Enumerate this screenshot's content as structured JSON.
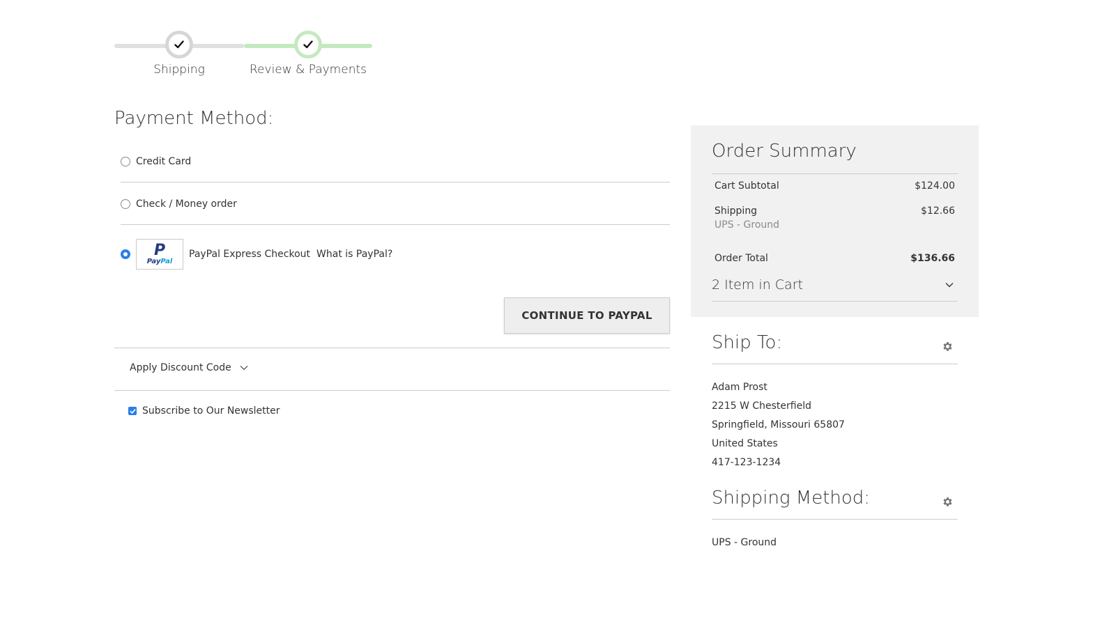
{
  "progress": {
    "steps": [
      {
        "label": "Shipping",
        "state": "complete"
      },
      {
        "label": "Review & Payments",
        "state": "active"
      }
    ],
    "colors": {
      "complete": "#d6d6d6",
      "active": "#c4e9c0"
    }
  },
  "payment": {
    "title": "Payment Method:",
    "options": [
      {
        "label": "Credit Card",
        "selected": false
      },
      {
        "label": "Check / Money order",
        "selected": false
      },
      {
        "label": "PayPal Express Checkout",
        "selected": true,
        "link": "What is PayPal?"
      }
    ],
    "paypal_logo": {
      "mark": "P",
      "word_a": "Pay",
      "word_b": "Pal"
    },
    "continue_label": "CONTINUE TO PAYPAL",
    "discount_label": "Apply Discount Code",
    "newsletter_label": "Subscribe to Our Newsletter",
    "newsletter_checked": true
  },
  "summary": {
    "title": "Order Summary",
    "subtotal_label": "Cart Subtotal",
    "subtotal_value": "$124.00",
    "shipping_label": "Shipping",
    "shipping_value": "$12.66",
    "shipping_method": "UPS - Ground",
    "total_label": "Order Total",
    "total_value": "$136.66",
    "items_label": "2 Item in Cart"
  },
  "ship_to": {
    "title": "Ship To:",
    "name": "Adam Prost",
    "street": "2215 W Chesterfield",
    "city": "Springfield, Missouri 65807",
    "country": "United States",
    "phone": "417-123-1234"
  },
  "shipping_method": {
    "title": "Shipping Method:",
    "value": "UPS - Ground"
  },
  "colors": {
    "accent": "#2d7ee8",
    "summary_bg": "#f1f1f1",
    "paypal_dark": "#253b80",
    "paypal_light": "#179bd7"
  }
}
